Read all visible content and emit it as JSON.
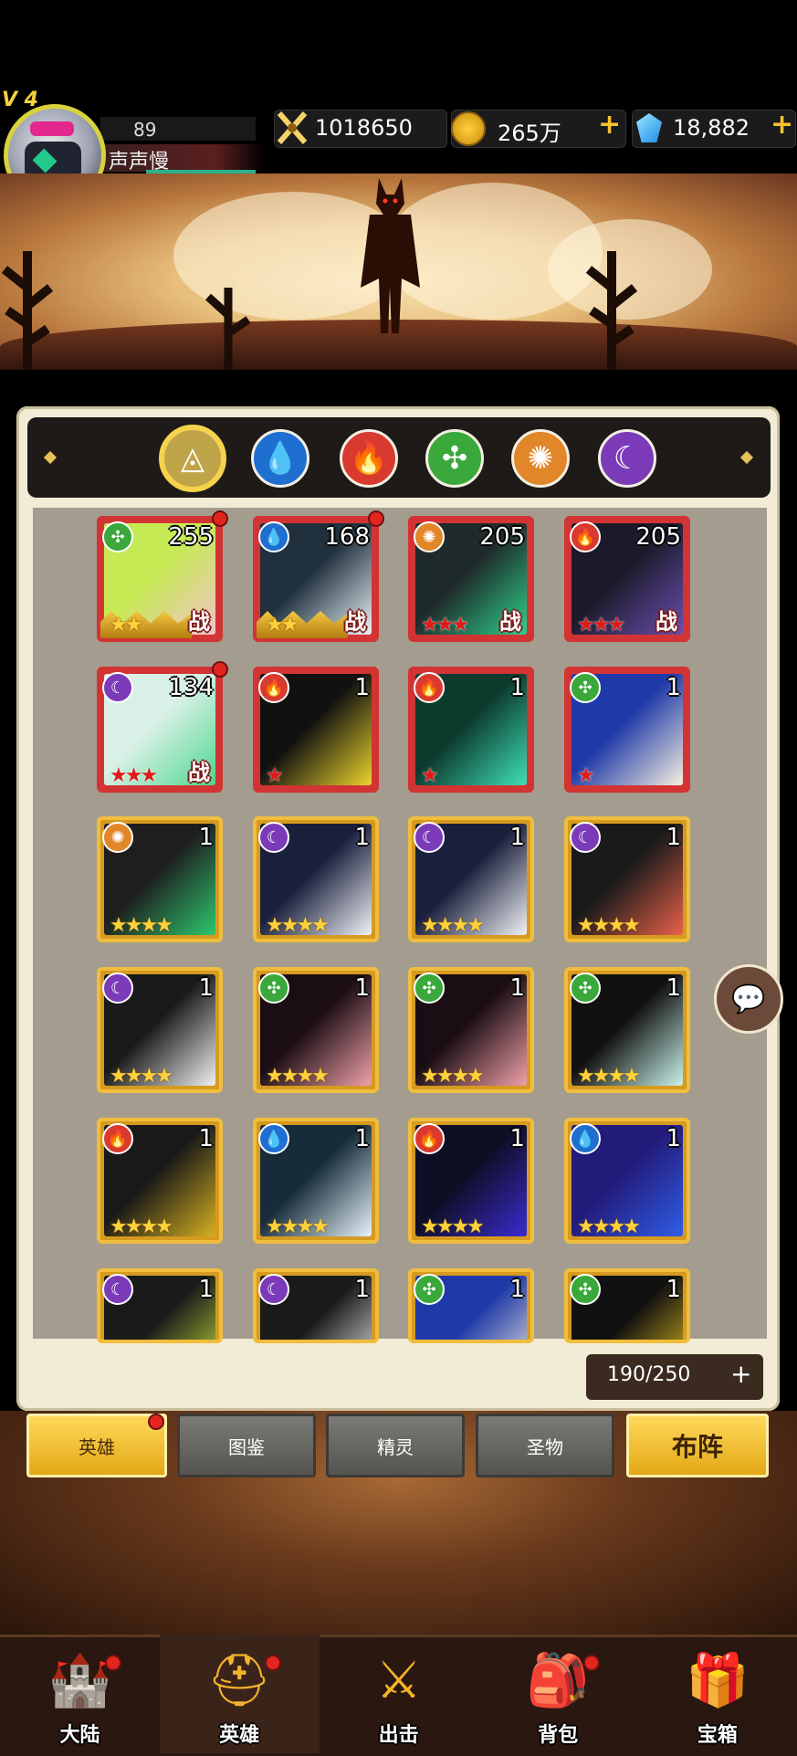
{
  "player": {
    "vip": "V 4",
    "level": "89",
    "name": "声声慢"
  },
  "resources": {
    "power": "1018650",
    "gold": "265万",
    "gems": "18,882",
    "plus": "+"
  },
  "filters": [
    {
      "name": "all",
      "icon": "◬",
      "color": "#bfa44a"
    },
    {
      "name": "water",
      "icon": "💧",
      "color": "#1f6fd0"
    },
    {
      "name": "fire",
      "icon": "🔥",
      "color": "#d93a2f"
    },
    {
      "name": "wind",
      "icon": "✣",
      "color": "#3aa83a"
    },
    {
      "name": "light",
      "icon": "✺",
      "color": "#e2862a"
    },
    {
      "name": "dark",
      "icon": "☾",
      "color": "#7b3bb8"
    }
  ],
  "heroes": [
    {
      "element": "wind",
      "level": "255",
      "frame": "red",
      "stars": "★★",
      "battle": "战",
      "crown": true,
      "dot": true,
      "art": [
        "#c6ea54",
        "#f2c3c6"
      ]
    },
    {
      "element": "water",
      "level": "168",
      "frame": "red",
      "stars": "★★",
      "battle": "战",
      "crown": true,
      "dot": true,
      "art": [
        "#20303d",
        "#e9f3f8"
      ]
    },
    {
      "element": "light",
      "level": "205",
      "frame": "red",
      "stars": "★★★",
      "battle": "战",
      "crown": false,
      "dot": false,
      "art": [
        "#1f2a2a",
        "#2dd18c"
      ]
    },
    {
      "element": "fire",
      "level": "205",
      "frame": "red",
      "stars": "★★★",
      "battle": "战",
      "crown": false,
      "dot": false,
      "art": [
        "#1b1a2a",
        "#6a4fb0"
      ]
    },
    {
      "element": "dark",
      "level": "134",
      "frame": "red",
      "stars": "★★★",
      "battle": "战",
      "crown": false,
      "dot": true,
      "art": [
        "#d8f0e6",
        "#4dd78e"
      ]
    },
    {
      "element": "fire",
      "level": "1",
      "frame": "red",
      "stars": "★",
      "battle": "",
      "crown": false,
      "dot": false,
      "art": [
        "#111",
        "#ecd52c"
      ]
    },
    {
      "element": "fire",
      "level": "1",
      "frame": "red",
      "stars": "★",
      "battle": "",
      "crown": false,
      "dot": false,
      "art": [
        "#0c3a2d",
        "#3fe0b8"
      ]
    },
    {
      "element": "wind",
      "level": "1",
      "frame": "red",
      "stars": "★",
      "battle": "",
      "crown": false,
      "dot": false,
      "art": [
        "#1f3aa8",
        "#f6f0e0"
      ]
    },
    {
      "element": "light",
      "level": "1",
      "frame": "gold",
      "stars": "★★★★",
      "battle": "",
      "crown": false,
      "dot": false,
      "art": [
        "#1e1e1e",
        "#2ec76f"
      ]
    },
    {
      "element": "dark",
      "level": "1",
      "frame": "gold",
      "stars": "★★★★",
      "battle": "",
      "crown": false,
      "dot": false,
      "art": [
        "#1a1f3c",
        "#f0f2f5"
      ]
    },
    {
      "element": "dark",
      "level": "1",
      "frame": "gold",
      "stars": "★★★★",
      "battle": "",
      "crown": false,
      "dot": false,
      "art": [
        "#1a1f3c",
        "#f0f2f5"
      ]
    },
    {
      "element": "dark",
      "level": "1",
      "frame": "gold",
      "stars": "★★★★",
      "battle": "",
      "crown": false,
      "dot": false,
      "art": [
        "#1a1a1a",
        "#e8614a"
      ]
    },
    {
      "element": "dark",
      "level": "1",
      "frame": "gold",
      "stars": "★★★★",
      "battle": "",
      "crown": false,
      "dot": false,
      "art": [
        "#1a1a1a",
        "#eef0f2"
      ]
    },
    {
      "element": "wind",
      "level": "1",
      "frame": "gold",
      "stars": "★★★★",
      "battle": "",
      "crown": false,
      "dot": false,
      "art": [
        "#1b0d14",
        "#f0a0a8"
      ]
    },
    {
      "element": "wind",
      "level": "1",
      "frame": "gold",
      "stars": "★★★★",
      "battle": "",
      "crown": false,
      "dot": false,
      "art": [
        "#1b0d14",
        "#f0a0a8"
      ]
    },
    {
      "element": "wind",
      "level": "1",
      "frame": "gold",
      "stars": "★★★★",
      "battle": "",
      "crown": false,
      "dot": false,
      "art": [
        "#111",
        "#c8f3ea"
      ]
    },
    {
      "element": "fire",
      "level": "1",
      "frame": "gold",
      "stars": "★★★★",
      "battle": "",
      "crown": false,
      "dot": false,
      "art": [
        "#1a1a1a",
        "#d6b020"
      ]
    },
    {
      "element": "water",
      "level": "1",
      "frame": "gold",
      "stars": "★★★★",
      "battle": "",
      "crown": false,
      "dot": false,
      "art": [
        "#172c3a",
        "#e6f3fb"
      ]
    },
    {
      "element": "fire",
      "level": "1",
      "frame": "gold",
      "stars": "★★★★",
      "battle": "",
      "crown": false,
      "dot": false,
      "art": [
        "#0e0e24",
        "#3a2bd0"
      ]
    },
    {
      "element": "water",
      "level": "1",
      "frame": "gold",
      "stars": "★★★★",
      "battle": "",
      "crown": false,
      "dot": false,
      "art": [
        "#231b7a",
        "#2f5ee8"
      ]
    },
    {
      "element": "dark",
      "level": "1",
      "frame": "gold",
      "stars": "",
      "battle": "",
      "crown": false,
      "dot": false,
      "art": [
        "#1a1a1a",
        "#c7e83a"
      ]
    },
    {
      "element": "dark",
      "level": "1",
      "frame": "gold",
      "stars": "",
      "battle": "",
      "crown": false,
      "dot": false,
      "art": [
        "#1a1a1a",
        "#f2f4f6"
      ]
    },
    {
      "element": "wind",
      "level": "1",
      "frame": "gold",
      "stars": "",
      "battle": "",
      "crown": false,
      "dot": false,
      "art": [
        "#1f3aa8",
        "#f6f0e0"
      ]
    },
    {
      "element": "wind",
      "level": "1",
      "frame": "gold",
      "stars": "",
      "battle": "",
      "crown": false,
      "dot": false,
      "art": [
        "#111",
        "#e8c21c"
      ]
    }
  ],
  "capacity": {
    "text": "190/250",
    "plus": "+"
  },
  "subtabs": {
    "heroes": "英雄",
    "codex": "图鉴",
    "spirits": "精灵",
    "relics": "圣物",
    "formation": "布阵"
  },
  "nav": [
    {
      "label": "大陆",
      "icon": "🏰",
      "dot": true
    },
    {
      "label": "英雄",
      "icon": "⛑",
      "dot": true
    },
    {
      "label": "出击",
      "icon": "⚔",
      "dot": false
    },
    {
      "label": "背包",
      "icon": "🎒",
      "dot": true
    },
    {
      "label": "宝箱",
      "icon": "🎁",
      "dot": false
    }
  ],
  "chat_icon": "💬"
}
